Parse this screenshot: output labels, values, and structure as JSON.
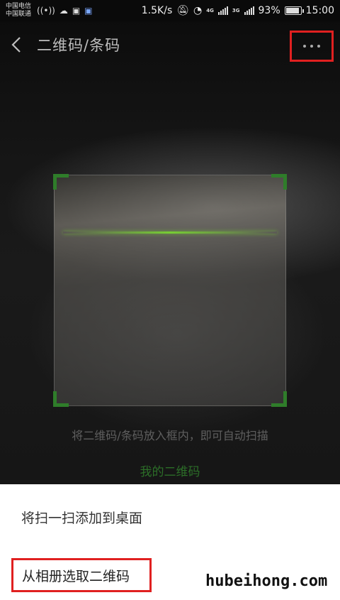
{
  "status_bar": {
    "carrier_1": "中国电信",
    "carrier_2": "中国联通",
    "net_speed": "1.5K/s",
    "net_tag_1": "4G",
    "net_tag_2": "3G",
    "battery": "93%",
    "battery_level": 0.93,
    "time": "15:00"
  },
  "nav": {
    "title": "二维码/条码"
  },
  "scanner": {
    "hint": "将二维码/条码放入框内，即可自动扫描",
    "my_qr": "我的二维码",
    "accent_color": "#2f7d2a"
  },
  "sheet": {
    "add_to_desktop": "将扫一扫添加到桌面",
    "pick_from_album": "从相册选取二维码"
  },
  "watermark": "hubeihong.com",
  "highlight_color": "#e02020"
}
